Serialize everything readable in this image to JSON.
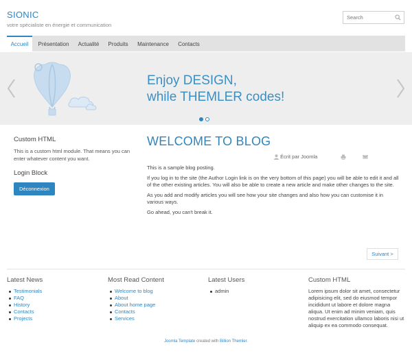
{
  "header": {
    "title": "SIONIC",
    "subtitle": "votre spécialiste en énergie et communication",
    "search_placeholder": "Search"
  },
  "nav": {
    "tabs": [
      {
        "label": "Accueil",
        "active": true
      },
      {
        "label": "Présentation"
      },
      {
        "label": "Actualité"
      },
      {
        "label": "Produits"
      },
      {
        "label": "Maintenance"
      },
      {
        "label": "Contacts"
      }
    ]
  },
  "slider": {
    "line1": "Enjoy DESIGN,",
    "line2": "while THEMLER codes!",
    "slide_count": 2,
    "active_slide": 1
  },
  "sidebar": {
    "custom_html_title": "Custom HTML",
    "custom_html_text": "This is a custom html module. That means you can enter whatever content you want.",
    "login_title": "Login Block",
    "logout_label": "Déconnexion"
  },
  "article": {
    "title": "WELCOME TO BLOG",
    "author": "Écrit par Joomla",
    "paragraphs": [
      "This is a sample blog posting.",
      "If you log in to the site (the Author Login link is on the very bottom of this page) you will be able to edit it and all of the other existing articles. You will also be able to create a new article and make other changes to the site.",
      "As you add and modify articles you will see how your site changes and also how you can customise it in various ways.",
      "Go ahead, you can't break it."
    ],
    "next_label": "Suivant >"
  },
  "footer": {
    "latest_news": {
      "title": "Latest News",
      "items": [
        "Testimonials",
        "FAQ",
        "History",
        "Contacts",
        "Projects"
      ]
    },
    "most_read": {
      "title": "Most Read Content",
      "items": [
        "Welcome to blog",
        "About",
        "About home page",
        "Contacts",
        "Services"
      ]
    },
    "latest_users": {
      "title": "Latest Users",
      "items": [
        "admin"
      ]
    },
    "custom_html": {
      "title": "Custom HTML",
      "text": "Lorem ipsum dolor sit amet, consectetur adipisicing elit, sed do eiusmod tempor incididunt ut labore et dolore magna aliqua. Ut enim ad minim veniam, quis nostrud exercitation ullamco laboris nisi ut aliquip ex ea commodo consequat."
    },
    "credits": {
      "link1": "Joomla Template",
      "middle": " created with ",
      "link2": "Billion Themler",
      "end": "."
    }
  },
  "colors": {
    "accent": "#2e86c1",
    "nav_bg": "#e2e2e2",
    "slider_bg": "#eeeeee"
  }
}
